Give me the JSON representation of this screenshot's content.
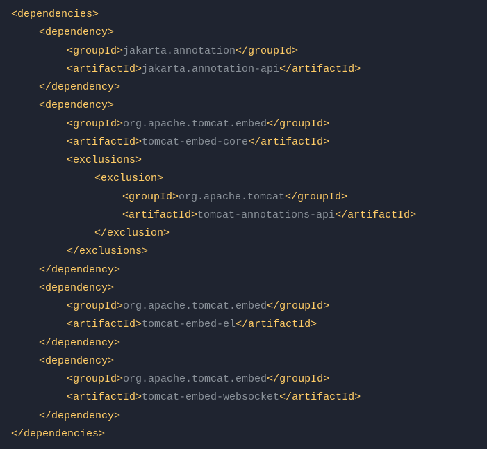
{
  "code": {
    "lines": [
      {
        "indent": "i1",
        "parts": [
          {
            "t": "tag",
            "v": "<dependencies>"
          }
        ]
      },
      {
        "indent": "i2",
        "parts": [
          {
            "t": "tag",
            "v": "<dependency>"
          }
        ]
      },
      {
        "indent": "i3",
        "parts": [
          {
            "t": "tag",
            "v": "<groupId>"
          },
          {
            "t": "text",
            "v": "jakarta.annotation"
          },
          {
            "t": "tag",
            "v": "</groupId>"
          }
        ]
      },
      {
        "indent": "i3",
        "parts": [
          {
            "t": "tag",
            "v": "<artifactId>"
          },
          {
            "t": "text",
            "v": "jakarta.annotation-api"
          },
          {
            "t": "tag",
            "v": "</artifactId>"
          }
        ]
      },
      {
        "indent": "i2",
        "parts": [
          {
            "t": "tag",
            "v": "</dependency>"
          }
        ]
      },
      {
        "indent": "i2",
        "parts": [
          {
            "t": "tag",
            "v": "<dependency>"
          }
        ]
      },
      {
        "indent": "i3",
        "parts": [
          {
            "t": "tag",
            "v": "<groupId>"
          },
          {
            "t": "text",
            "v": "org.apache.tomcat.embed"
          },
          {
            "t": "tag",
            "v": "</groupId>"
          }
        ]
      },
      {
        "indent": "i3",
        "parts": [
          {
            "t": "tag",
            "v": "<artifactId>"
          },
          {
            "t": "text",
            "v": "tomcat-embed-core"
          },
          {
            "t": "tag",
            "v": "</artifactId>"
          }
        ]
      },
      {
        "indent": "i3",
        "parts": [
          {
            "t": "tag",
            "v": "<exclusions>"
          }
        ]
      },
      {
        "indent": "i4",
        "parts": [
          {
            "t": "tag",
            "v": "<exclusion>"
          }
        ]
      },
      {
        "indent": "i5",
        "parts": [
          {
            "t": "tag",
            "v": "<groupId>"
          },
          {
            "t": "text",
            "v": "org.apache.tomcat"
          },
          {
            "t": "tag",
            "v": "</groupId>"
          }
        ]
      },
      {
        "indent": "i5",
        "parts": [
          {
            "t": "tag",
            "v": "<artifactId>"
          },
          {
            "t": "text",
            "v": "tomcat-annotations-api"
          },
          {
            "t": "tag",
            "v": "</artifactId>"
          }
        ]
      },
      {
        "indent": "i4",
        "parts": [
          {
            "t": "tag",
            "v": "</exclusion>"
          }
        ]
      },
      {
        "indent": "i3",
        "parts": [
          {
            "t": "tag",
            "v": "</exclusions>"
          }
        ]
      },
      {
        "indent": "i2",
        "parts": [
          {
            "t": "tag",
            "v": "</dependency>"
          }
        ]
      },
      {
        "indent": "i2",
        "parts": [
          {
            "t": "tag",
            "v": "<dependency>"
          }
        ]
      },
      {
        "indent": "i3",
        "parts": [
          {
            "t": "tag",
            "v": "<groupId>"
          },
          {
            "t": "text",
            "v": "org.apache.tomcat.embed"
          },
          {
            "t": "tag",
            "v": "</groupId>"
          }
        ]
      },
      {
        "indent": "i3",
        "parts": [
          {
            "t": "tag",
            "v": "<artifactId>"
          },
          {
            "t": "text",
            "v": "tomcat-embed-el"
          },
          {
            "t": "tag",
            "v": "</artifactId>"
          }
        ]
      },
      {
        "indent": "i2",
        "parts": [
          {
            "t": "tag",
            "v": "</dependency>"
          }
        ]
      },
      {
        "indent": "i2",
        "parts": [
          {
            "t": "tag",
            "v": "<dependency>"
          }
        ]
      },
      {
        "indent": "i3",
        "parts": [
          {
            "t": "tag",
            "v": "<groupId>"
          },
          {
            "t": "text",
            "v": "org.apache.tomcat.embed"
          },
          {
            "t": "tag",
            "v": "</groupId>"
          }
        ]
      },
      {
        "indent": "i3",
        "parts": [
          {
            "t": "tag",
            "v": "<artifactId>"
          },
          {
            "t": "text",
            "v": "tomcat-embed-websocket"
          },
          {
            "t": "tag",
            "v": "</artifactId>"
          }
        ]
      },
      {
        "indent": "i2",
        "parts": [
          {
            "t": "tag",
            "v": "</dependency>"
          }
        ]
      },
      {
        "indent": "i1",
        "parts": [
          {
            "t": "tag",
            "v": "</dependencies>"
          }
        ]
      }
    ]
  }
}
